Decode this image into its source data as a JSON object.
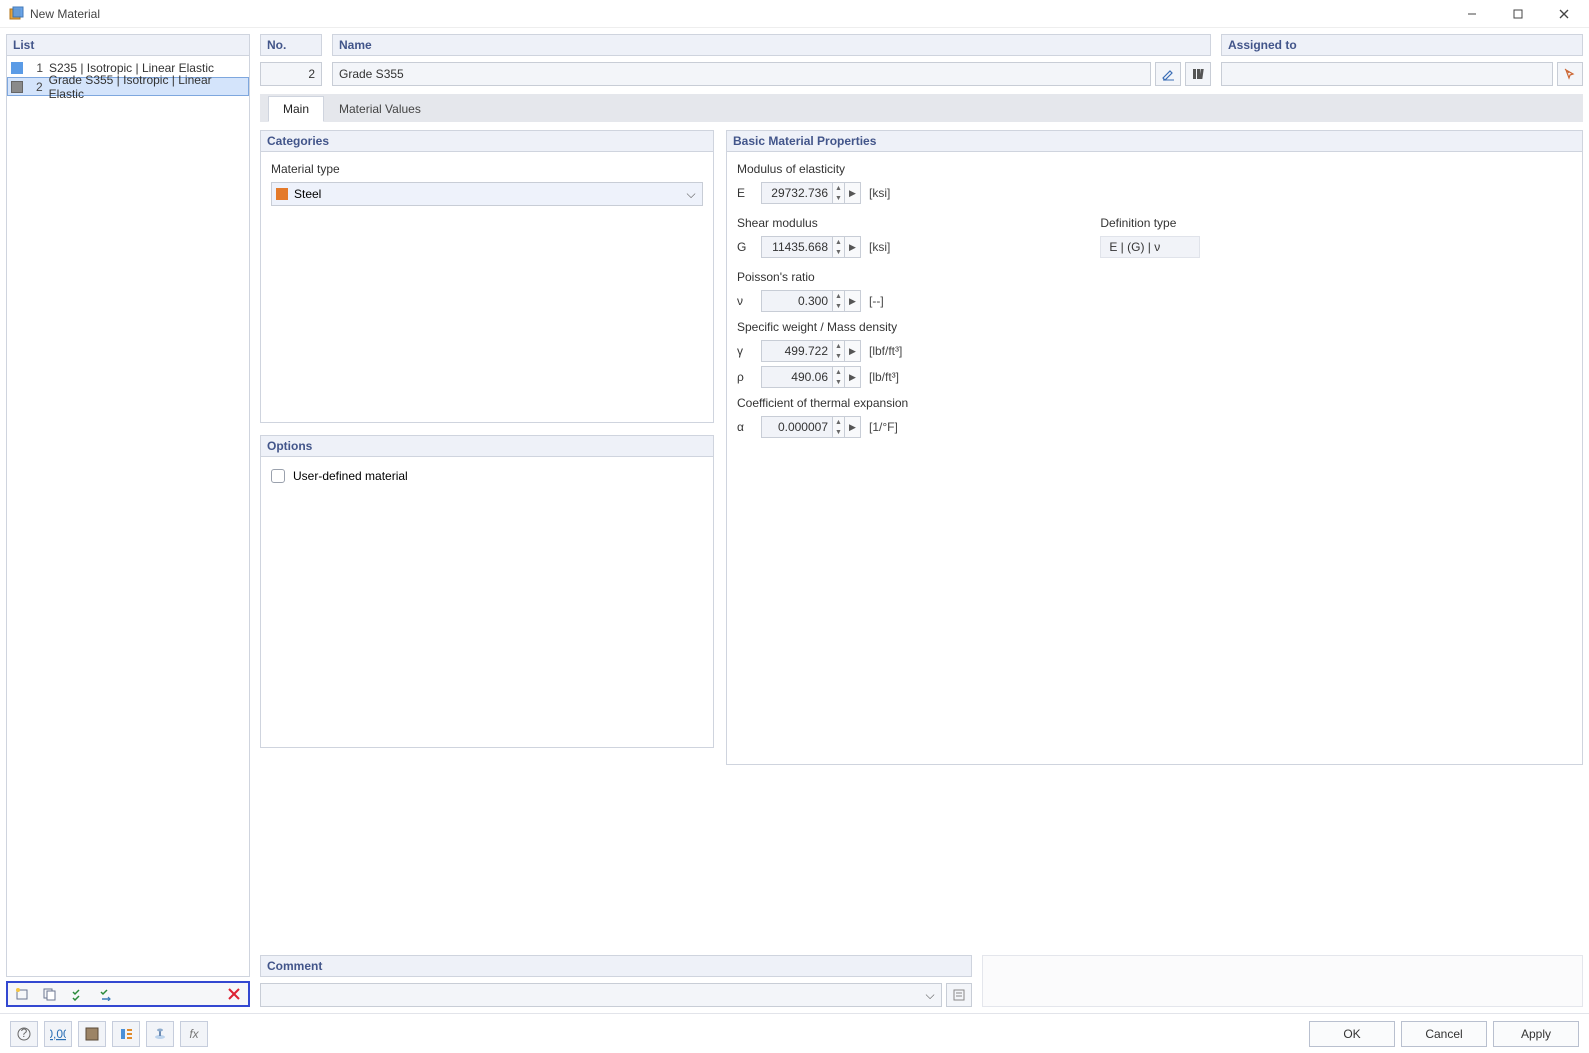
{
  "window": {
    "title": "New Material"
  },
  "list": {
    "header": "List",
    "items": [
      {
        "num": "1",
        "label": "S235 | Isotropic | Linear Elastic",
        "swatch": "blue",
        "selected": false
      },
      {
        "num": "2",
        "label": "Grade S355 | Isotropic | Linear Elastic",
        "swatch": "grey",
        "selected": true
      }
    ]
  },
  "no": {
    "header": "No.",
    "value": "2"
  },
  "name": {
    "header": "Name",
    "value": "Grade S355"
  },
  "assigned": {
    "header": "Assigned to",
    "value": ""
  },
  "tabs": {
    "main": "Main",
    "material_values": "Material Values"
  },
  "categories": {
    "header": "Categories",
    "material_type_label": "Material type",
    "material_type_value": "Steel"
  },
  "options": {
    "header": "Options",
    "user_defined_label": "User-defined material",
    "user_defined_checked": false
  },
  "props": {
    "header": "Basic Material Properties",
    "elasticity_label": "Modulus of elasticity",
    "E_sym": "E",
    "E_val": "29732.736",
    "E_unit": "[ksi]",
    "shear_label": "Shear modulus",
    "G_sym": "G",
    "G_val": "11435.668",
    "G_unit": "[ksi]",
    "def_label": "Definition type",
    "def_value": "E | (G) | ν",
    "poisson_label": "Poisson's ratio",
    "nu_sym": "ν",
    "nu_val": "0.300",
    "nu_unit": "[--]",
    "density_label": "Specific weight / Mass density",
    "gamma_sym": "γ",
    "gamma_val": "499.722",
    "gamma_unit": "[lbf/ft³]",
    "rho_sym": "ρ",
    "rho_val": "490.06",
    "rho_unit": "[lb/ft³]",
    "thermal_label": "Coefficient of thermal expansion",
    "alpha_sym": "α",
    "alpha_val": "0.000007",
    "alpha_unit": "[1/°F]"
  },
  "comment": {
    "header": "Comment",
    "value": ""
  },
  "buttons": {
    "ok": "OK",
    "cancel": "Cancel",
    "apply": "Apply"
  }
}
